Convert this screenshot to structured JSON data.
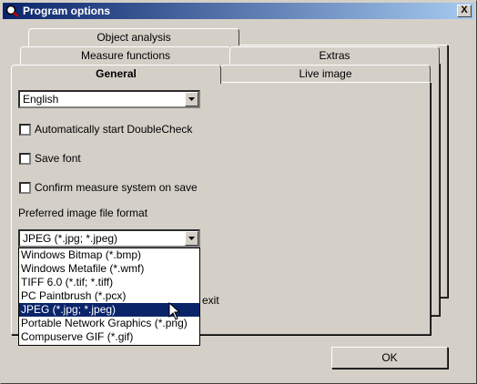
{
  "window": {
    "title": "Program options",
    "close_label": "X"
  },
  "tabs": {
    "object_analysis": "Object analysis",
    "measure_functions": "Measure functions",
    "extras": "Extras",
    "general": "General",
    "live_image": "Live image"
  },
  "general": {
    "language_value": "English",
    "auto_start_label": "Automatically start DoubleCheck",
    "save_font_label": "Save font",
    "confirm_measure_label": "Confirm measure system on save",
    "preferred_format_label": "Preferred image file format",
    "format_value": "JPEG (*.jpg; *.jpeg)",
    "hidden_exit_text": "exit",
    "format_options": [
      "Windows Bitmap (*.bmp)",
      "Windows Metafile (*.wmf)",
      "TIFF 6.0 (*.tif; *.tiff)",
      "PC Paintbrush (*.pcx)",
      "JPEG (*.jpg; *.jpeg)",
      "Portable Network Graphics (*.png)",
      "Compuserve GIF (*.gif)"
    ]
  },
  "buttons": {
    "ok": "OK"
  }
}
